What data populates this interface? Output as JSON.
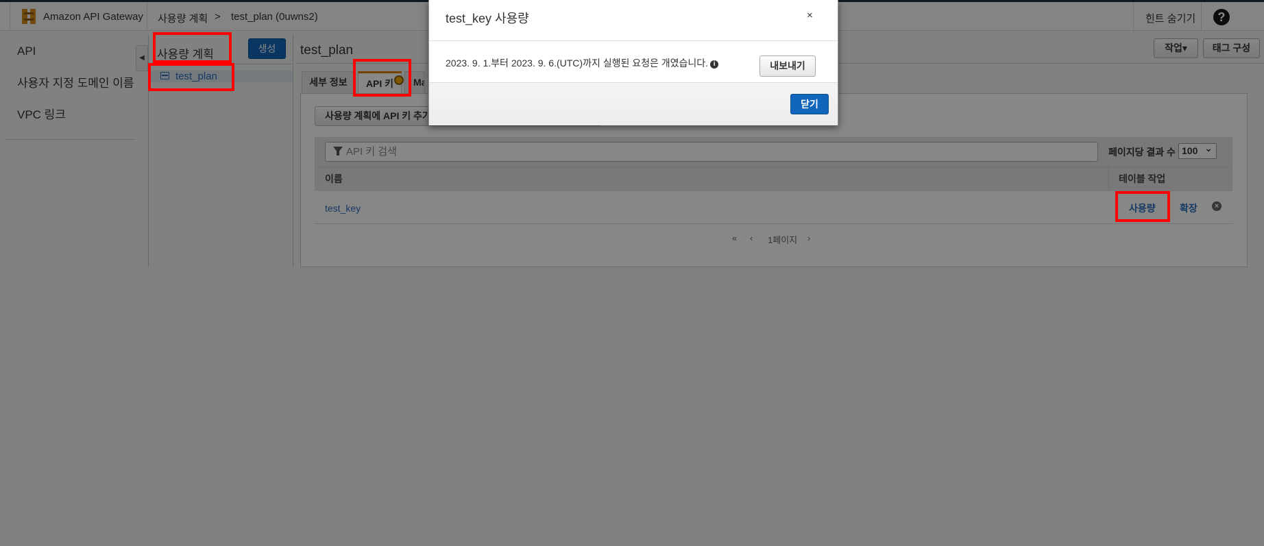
{
  "header": {
    "brand": "Amazon API Gateway",
    "breadcrumb_root": "사용량 계획",
    "breadcrumb_separator": ">",
    "breadcrumb_current": "test_plan (0uwns2)",
    "hints_toggle": "힌트 숨기기",
    "help": "?"
  },
  "sidebar": {
    "items": [
      "API",
      "사용자 지정 도메인 이름",
      "VPC 링크"
    ]
  },
  "plans": {
    "title": "사용량 계획",
    "create_button": "생성",
    "items": [
      "test_plan"
    ]
  },
  "main": {
    "title": "test_plan",
    "actions_button": "작업▾",
    "tags_button": "태그 구성",
    "tabs": [
      "세부 정보",
      "API 키",
      "Ma"
    ],
    "add_key_button": "사용량 계획에 API 키 추가",
    "search_placeholder": "API 키 검색",
    "per_page_label": "페이지당 결과 수",
    "per_page_value": "100",
    "table": {
      "columns": [
        "이름",
        "테이블 작업"
      ],
      "rows": [
        {
          "name": "test_key",
          "actions": [
            "사용량",
            "확장"
          ]
        }
      ]
    },
    "pagination": {
      "first": "«",
      "prev": "‹",
      "page": "1페이지",
      "next": "›"
    }
  },
  "modal": {
    "title": "test_key 사용량",
    "close_x": "×",
    "message": "2023. 9. 1.부터 2023. 9. 6.(UTC)까지 실행된 요청은 개였습니다.",
    "export_button": "내보내기",
    "close_button": "닫기"
  },
  "colors": {
    "primary": "#1166bb",
    "link": "#2a6ebb",
    "highlight": "#ff0000",
    "tab_accent": "#e07b00"
  }
}
